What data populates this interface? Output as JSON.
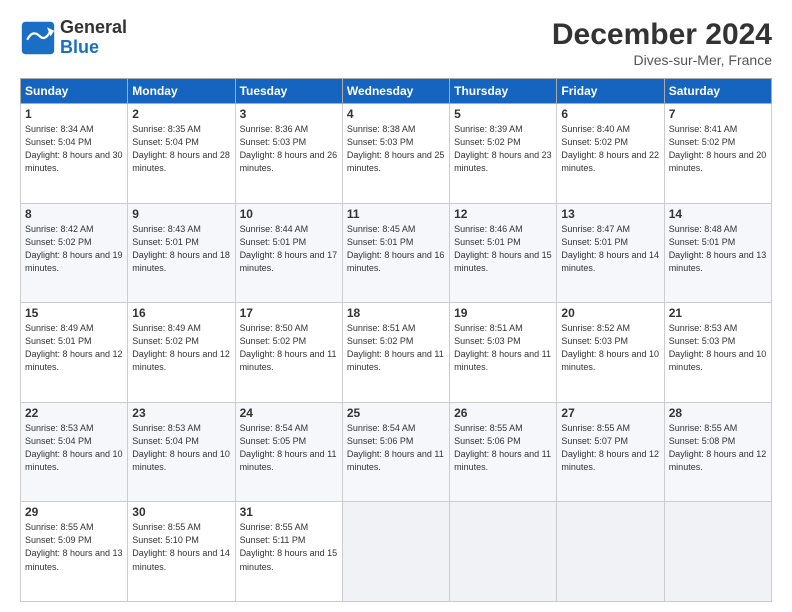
{
  "header": {
    "logo_general": "General",
    "logo_blue": "Blue",
    "month_title": "December 2024",
    "location": "Dives-sur-Mer, France"
  },
  "weekdays": [
    "Sunday",
    "Monday",
    "Tuesday",
    "Wednesday",
    "Thursday",
    "Friday",
    "Saturday"
  ],
  "weeks": [
    [
      {
        "day": "1",
        "sunrise": "Sunrise: 8:34 AM",
        "sunset": "Sunset: 5:04 PM",
        "daylight": "Daylight: 8 hours and 30 minutes."
      },
      {
        "day": "2",
        "sunrise": "Sunrise: 8:35 AM",
        "sunset": "Sunset: 5:04 PM",
        "daylight": "Daylight: 8 hours and 28 minutes."
      },
      {
        "day": "3",
        "sunrise": "Sunrise: 8:36 AM",
        "sunset": "Sunset: 5:03 PM",
        "daylight": "Daylight: 8 hours and 26 minutes."
      },
      {
        "day": "4",
        "sunrise": "Sunrise: 8:38 AM",
        "sunset": "Sunset: 5:03 PM",
        "daylight": "Daylight: 8 hours and 25 minutes."
      },
      {
        "day": "5",
        "sunrise": "Sunrise: 8:39 AM",
        "sunset": "Sunset: 5:02 PM",
        "daylight": "Daylight: 8 hours and 23 minutes."
      },
      {
        "day": "6",
        "sunrise": "Sunrise: 8:40 AM",
        "sunset": "Sunset: 5:02 PM",
        "daylight": "Daylight: 8 hours and 22 minutes."
      },
      {
        "day": "7",
        "sunrise": "Sunrise: 8:41 AM",
        "sunset": "Sunset: 5:02 PM",
        "daylight": "Daylight: 8 hours and 20 minutes."
      }
    ],
    [
      {
        "day": "8",
        "sunrise": "Sunrise: 8:42 AM",
        "sunset": "Sunset: 5:02 PM",
        "daylight": "Daylight: 8 hours and 19 minutes."
      },
      {
        "day": "9",
        "sunrise": "Sunrise: 8:43 AM",
        "sunset": "Sunset: 5:01 PM",
        "daylight": "Daylight: 8 hours and 18 minutes."
      },
      {
        "day": "10",
        "sunrise": "Sunrise: 8:44 AM",
        "sunset": "Sunset: 5:01 PM",
        "daylight": "Daylight: 8 hours and 17 minutes."
      },
      {
        "day": "11",
        "sunrise": "Sunrise: 8:45 AM",
        "sunset": "Sunset: 5:01 PM",
        "daylight": "Daylight: 8 hours and 16 minutes."
      },
      {
        "day": "12",
        "sunrise": "Sunrise: 8:46 AM",
        "sunset": "Sunset: 5:01 PM",
        "daylight": "Daylight: 8 hours and 15 minutes."
      },
      {
        "day": "13",
        "sunrise": "Sunrise: 8:47 AM",
        "sunset": "Sunset: 5:01 PM",
        "daylight": "Daylight: 8 hours and 14 minutes."
      },
      {
        "day": "14",
        "sunrise": "Sunrise: 8:48 AM",
        "sunset": "Sunset: 5:01 PM",
        "daylight": "Daylight: 8 hours and 13 minutes."
      }
    ],
    [
      {
        "day": "15",
        "sunrise": "Sunrise: 8:49 AM",
        "sunset": "Sunset: 5:01 PM",
        "daylight": "Daylight: 8 hours and 12 minutes."
      },
      {
        "day": "16",
        "sunrise": "Sunrise: 8:49 AM",
        "sunset": "Sunset: 5:02 PM",
        "daylight": "Daylight: 8 hours and 12 minutes."
      },
      {
        "day": "17",
        "sunrise": "Sunrise: 8:50 AM",
        "sunset": "Sunset: 5:02 PM",
        "daylight": "Daylight: 8 hours and 11 minutes."
      },
      {
        "day": "18",
        "sunrise": "Sunrise: 8:51 AM",
        "sunset": "Sunset: 5:02 PM",
        "daylight": "Daylight: 8 hours and 11 minutes."
      },
      {
        "day": "19",
        "sunrise": "Sunrise: 8:51 AM",
        "sunset": "Sunset: 5:03 PM",
        "daylight": "Daylight: 8 hours and 11 minutes."
      },
      {
        "day": "20",
        "sunrise": "Sunrise: 8:52 AM",
        "sunset": "Sunset: 5:03 PM",
        "daylight": "Daylight: 8 hours and 10 minutes."
      },
      {
        "day": "21",
        "sunrise": "Sunrise: 8:53 AM",
        "sunset": "Sunset: 5:03 PM",
        "daylight": "Daylight: 8 hours and 10 minutes."
      }
    ],
    [
      {
        "day": "22",
        "sunrise": "Sunrise: 8:53 AM",
        "sunset": "Sunset: 5:04 PM",
        "daylight": "Daylight: 8 hours and 10 minutes."
      },
      {
        "day": "23",
        "sunrise": "Sunrise: 8:53 AM",
        "sunset": "Sunset: 5:04 PM",
        "daylight": "Daylight: 8 hours and 10 minutes."
      },
      {
        "day": "24",
        "sunrise": "Sunrise: 8:54 AM",
        "sunset": "Sunset: 5:05 PM",
        "daylight": "Daylight: 8 hours and 11 minutes."
      },
      {
        "day": "25",
        "sunrise": "Sunrise: 8:54 AM",
        "sunset": "Sunset: 5:06 PM",
        "daylight": "Daylight: 8 hours and 11 minutes."
      },
      {
        "day": "26",
        "sunrise": "Sunrise: 8:55 AM",
        "sunset": "Sunset: 5:06 PM",
        "daylight": "Daylight: 8 hours and 11 minutes."
      },
      {
        "day": "27",
        "sunrise": "Sunrise: 8:55 AM",
        "sunset": "Sunset: 5:07 PM",
        "daylight": "Daylight: 8 hours and 12 minutes."
      },
      {
        "day": "28",
        "sunrise": "Sunrise: 8:55 AM",
        "sunset": "Sunset: 5:08 PM",
        "daylight": "Daylight: 8 hours and 12 minutes."
      }
    ],
    [
      {
        "day": "29",
        "sunrise": "Sunrise: 8:55 AM",
        "sunset": "Sunset: 5:09 PM",
        "daylight": "Daylight: 8 hours and 13 minutes."
      },
      {
        "day": "30",
        "sunrise": "Sunrise: 8:55 AM",
        "sunset": "Sunset: 5:10 PM",
        "daylight": "Daylight: 8 hours and 14 minutes."
      },
      {
        "day": "31",
        "sunrise": "Sunrise: 8:55 AM",
        "sunset": "Sunset: 5:11 PM",
        "daylight": "Daylight: 8 hours and 15 minutes."
      },
      null,
      null,
      null,
      null
    ]
  ]
}
